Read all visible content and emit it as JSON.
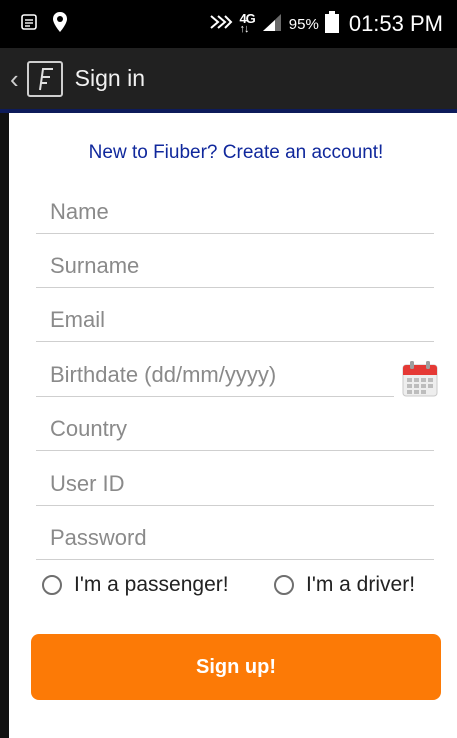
{
  "status_bar": {
    "network_top": "4G",
    "network_bottom": "↑↓",
    "battery_percent": "95%",
    "time": "01:53 PM"
  },
  "action_bar": {
    "back_icon": "chevron-left-icon",
    "logo_icon": "fiuber-logo-icon",
    "title": "Sign in"
  },
  "form": {
    "create_account_link": "New to Fiuber? Create an account!",
    "fields": {
      "name": {
        "value": "",
        "placeholder": "Name"
      },
      "surname": {
        "value": "",
        "placeholder": "Surname"
      },
      "email": {
        "value": "",
        "placeholder": "Email"
      },
      "birthdate": {
        "value": "",
        "placeholder": "Birthdate (dd/mm/yyyy)"
      },
      "country": {
        "value": "",
        "placeholder": "Country"
      },
      "user_id": {
        "value": "",
        "placeholder": "User ID"
      },
      "password": {
        "value": "",
        "placeholder": "Password"
      }
    },
    "calendar_icon": "calendar-icon",
    "role_options": [
      {
        "label": "I'm a passenger!",
        "selected": false
      },
      {
        "label": "I'm a driver!",
        "selected": false
      }
    ],
    "submit_label": "Sign up!"
  },
  "colors": {
    "accent": "#fc7a06",
    "link": "#10289c",
    "action_bar": "#212121",
    "status_bar": "#000000"
  }
}
